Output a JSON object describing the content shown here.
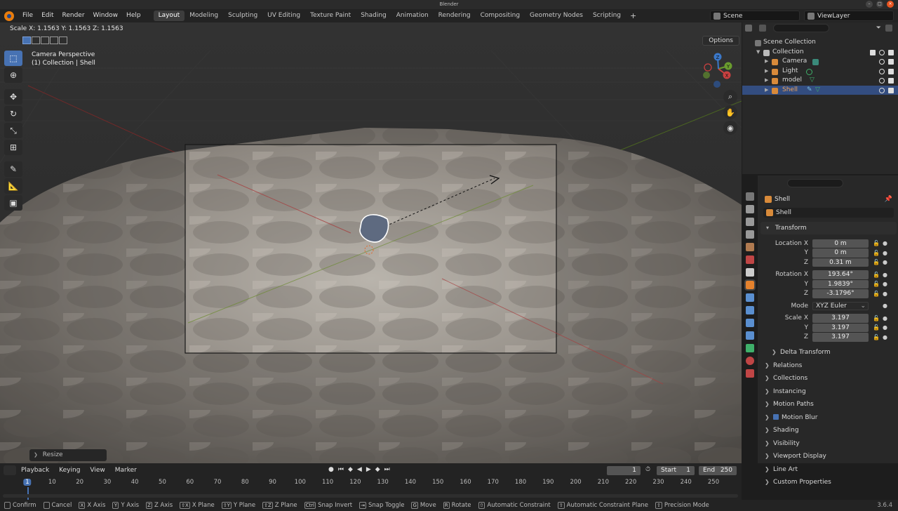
{
  "window": {
    "title": "Blender",
    "version": "3.6.4"
  },
  "menu": [
    "File",
    "Edit",
    "Render",
    "Window",
    "Help"
  ],
  "workspaces": [
    "Layout",
    "Modeling",
    "Sculpting",
    "UV Editing",
    "Texture Paint",
    "Shading",
    "Animation",
    "Rendering",
    "Compositing",
    "Geometry Nodes",
    "Scripting"
  ],
  "active_workspace": "Layout",
  "scene": "Scene",
  "view_layer": "ViewLayer",
  "viewport": {
    "scale_readout": "Scale X: 1.1563    Y: 1.1563    Z: 1.1563",
    "view_name": "Camera Perspective",
    "collection_line": "(1) Collection | Shell",
    "options_label": "Options",
    "resize_panel": "Resize",
    "gizmo": {
      "x": "X",
      "y": "Y",
      "z": "Z"
    }
  },
  "outliner": {
    "root": "Scene Collection",
    "collection": "Collection",
    "items": [
      {
        "name": "Camera",
        "selected": false,
        "color": "#d88a3a"
      },
      {
        "name": "Light",
        "selected": false,
        "color": "#d88a3a"
      },
      {
        "name": "model",
        "selected": false,
        "color": "#d88a3a"
      },
      {
        "name": "Shell",
        "selected": true,
        "color": "#d88a3a"
      }
    ]
  },
  "properties": {
    "object_name": "Shell",
    "object_field": "Shell",
    "transform_label": "Transform",
    "location": {
      "label_x": "Location X",
      "x": "0 m",
      "y": "0 m",
      "z": "0.31 m"
    },
    "rotation": {
      "label_x": "Rotation X",
      "x": "193.64°",
      "y": "1.9839°",
      "z": "-3.1796°"
    },
    "mode": {
      "label": "Mode",
      "value": "XYZ Euler"
    },
    "scale": {
      "label_x": "Scale X",
      "x": "3.197",
      "y": "3.197",
      "z": "3.197"
    },
    "axis_y": "Y",
    "axis_z": "Z",
    "delta": "Delta Transform",
    "panels": [
      "Relations",
      "Collections",
      "Instancing",
      "Motion Paths",
      "Motion Blur",
      "Shading",
      "Visibility",
      "Viewport Display",
      "Line Art",
      "Custom Properties"
    ]
  },
  "timeline": {
    "menus": [
      "Playback",
      "Keying",
      "View",
      "Marker"
    ],
    "current_frame": "1",
    "start_label": "Start",
    "start": "1",
    "end_label": "End",
    "end": "250",
    "ruler": [
      "1",
      "10",
      "20",
      "30",
      "40",
      "50",
      "60",
      "70",
      "80",
      "90",
      "100",
      "110",
      "120",
      "130",
      "140",
      "150",
      "160",
      "170",
      "180",
      "190",
      "200",
      "210",
      "220",
      "230",
      "240",
      "250"
    ]
  },
  "statusbar": [
    {
      "key": "",
      "label": "Confirm"
    },
    {
      "key": "",
      "label": "Cancel"
    },
    {
      "key": "X",
      "label": "X Axis"
    },
    {
      "key": "Y",
      "label": "Y Axis"
    },
    {
      "key": "Z",
      "label": "Z Axis"
    },
    {
      "key": "⇧X",
      "label": "X Plane"
    },
    {
      "key": "⇧Y",
      "label": "Y Plane"
    },
    {
      "key": "⇧Z",
      "label": "Z Plane"
    },
    {
      "key": "Ctrl",
      "label": "Snap Invert"
    },
    {
      "key": "⇥",
      "label": "Snap Toggle"
    },
    {
      "key": "G",
      "label": "Move"
    },
    {
      "key": "R",
      "label": "Rotate"
    },
    {
      "key": "⇧",
      "label": "Automatic Constraint"
    },
    {
      "key": "⇧",
      "label": "Automatic Constraint Plane"
    },
    {
      "key": "⇧",
      "label": "Precision Mode"
    }
  ]
}
